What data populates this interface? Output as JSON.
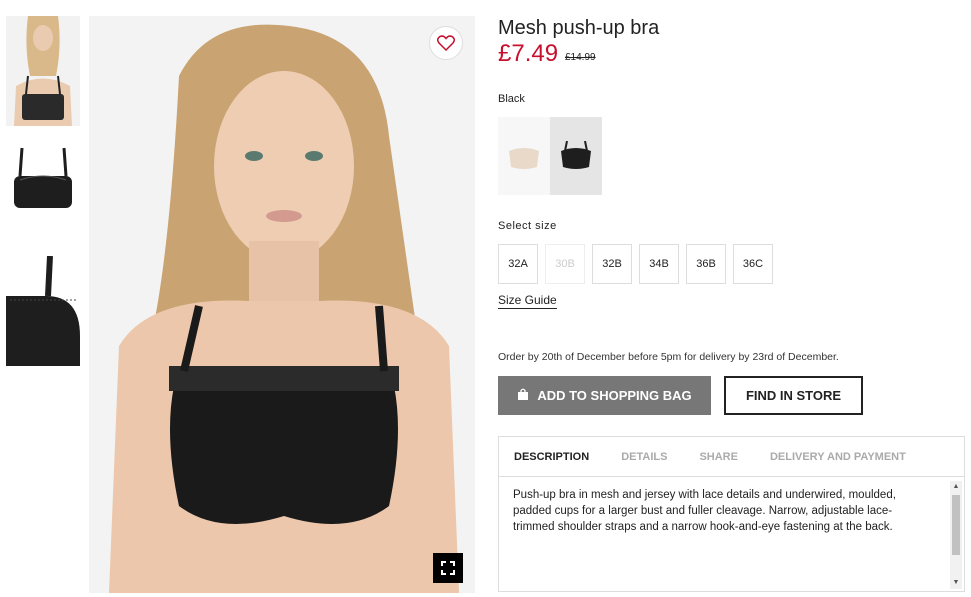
{
  "product": {
    "title": "Mesh push-up bra",
    "price": "£7.49",
    "old_price": "£14.99",
    "color_name": "Black",
    "colors": [
      "beige",
      "black"
    ],
    "selected_color": "black"
  },
  "sizes": {
    "label": "Select size",
    "options": [
      "32A",
      "30B",
      "32B",
      "34B",
      "36B",
      "36C"
    ],
    "unavailable": [
      "30B"
    ],
    "guide_label": "Size Guide"
  },
  "delivery_note": "Order by 20th of December before 5pm for delivery by 23rd of December.",
  "actions": {
    "add_to_bag": "ADD TO SHOPPING BAG",
    "find_in_store": "FIND IN STORE"
  },
  "tabs": {
    "items": [
      "DESCRIPTION",
      "DETAILS",
      "SHARE",
      "DELIVERY AND PAYMENT"
    ],
    "active": "DESCRIPTION",
    "description": "Push-up bra in mesh and jersey with lace details and underwired, moulded, padded cups for a larger bust and fuller cleavage. Narrow, adjustable lace-trimmed shoulder straps and a narrow hook-and-eye fastening at the back."
  },
  "icons": {
    "favorite": "heart-icon",
    "expand": "expand-icon",
    "bag": "shopping-bag-icon"
  },
  "colors": {
    "price_red": "#c8102e",
    "bag_button": "#777777"
  }
}
